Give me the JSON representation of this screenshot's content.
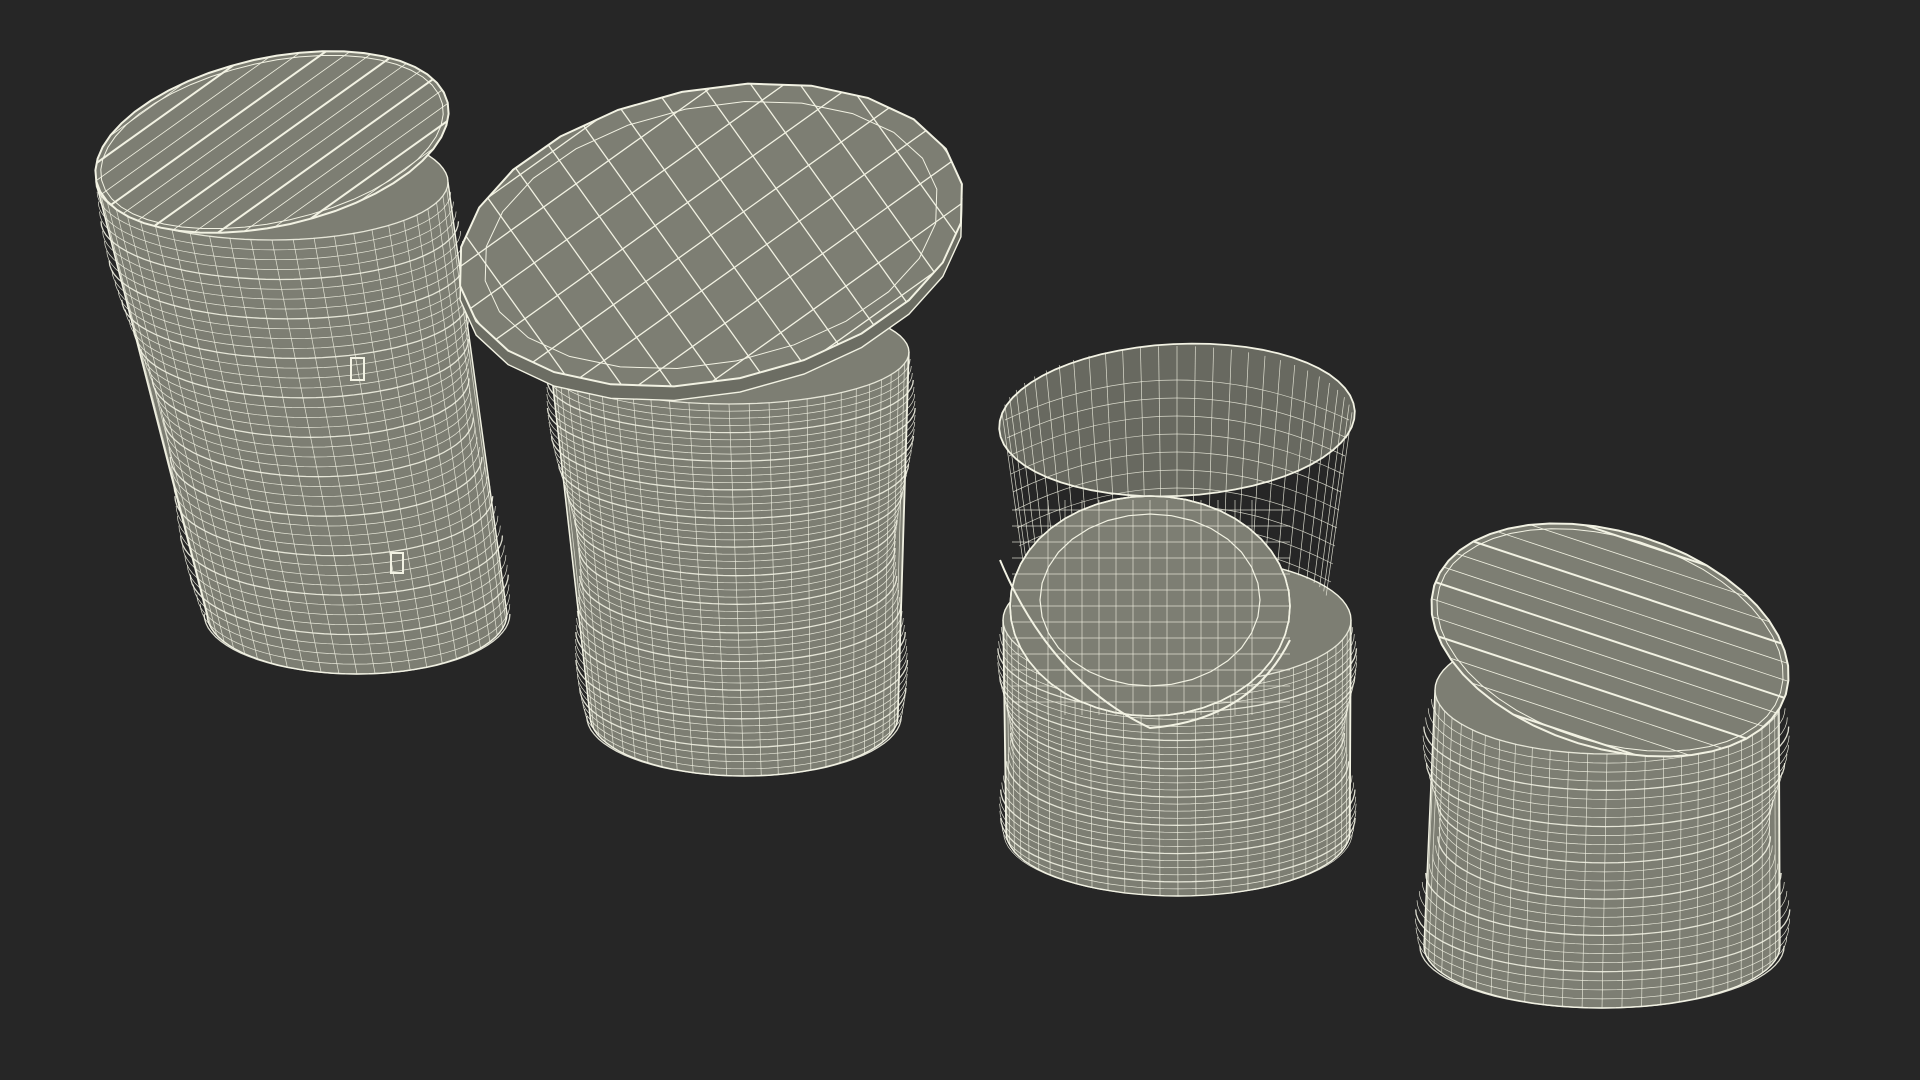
{
  "scene": {
    "background": "#262626",
    "surface_fill": "#7d7e73",
    "surface_shade": "#6c6d63",
    "inner_shade": "#686960",
    "wire_color": "#f2f2e3",
    "objects": [
      {
        "name": "tall-barrel-with-plank-lid",
        "kind": "barrel",
        "lid": "planks"
      },
      {
        "name": "barrel-table-with-round-top",
        "kind": "table",
        "lid": "grid"
      },
      {
        "name": "barrel-armchair",
        "kind": "chair",
        "lid": "none"
      },
      {
        "name": "short-barrel-stool",
        "kind": "stool",
        "lid": "planks"
      }
    ]
  }
}
